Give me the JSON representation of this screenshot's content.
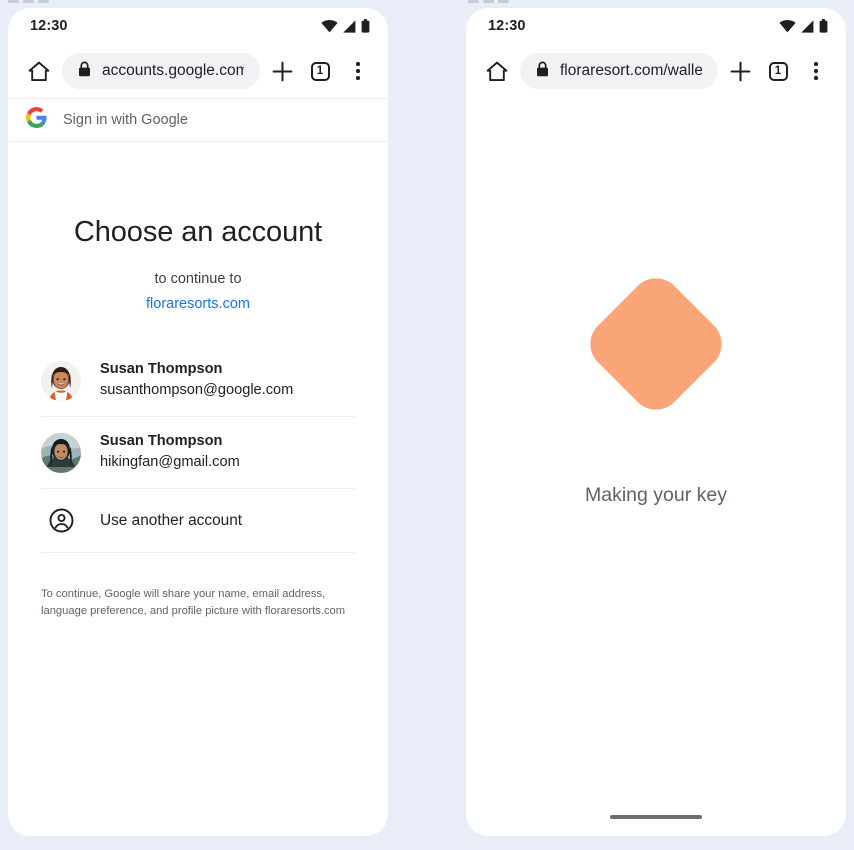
{
  "theme": {
    "page_background": "#e9edf7",
    "panel_background": "#ffffff",
    "link_blue": "#1a73e8",
    "key_shape_color": "#faa578",
    "muted_text": "#5f6368"
  },
  "phones": [
    {
      "id": "left",
      "status_bar": {
        "time": "12:30",
        "icons": [
          "wifi-icon",
          "cell-signal-icon",
          "battery-icon"
        ]
      },
      "toolbar": {
        "home_icon": "home-icon",
        "lock_icon": "lock-icon",
        "url": "accounts.google.com/o/",
        "new_tab_icon": "plus-icon",
        "tab_count": "1",
        "menu_icon": "overflow-menu-icon"
      },
      "google_header": {
        "logo": "google-g-icon",
        "label": "Sign in with Google"
      },
      "content": {
        "headline": "Choose an account",
        "subline": "to continue to",
        "app_domain": "floraresorts.com",
        "accounts": [
          {
            "name": "Susan Thompson",
            "email": "susanthompson@google.com",
            "avatar": "avatar-photo-smiling-woman"
          },
          {
            "name": "Susan Thompson",
            "email": "hikingfan@gmail.com",
            "avatar": "avatar-photo-woman-outdoors"
          }
        ],
        "use_another_account": {
          "icon": "account-circle-icon",
          "label": "Use another account"
        },
        "disclaimer": "To continue, Google will share your name, email address, language preference, and profile picture with floraresorts.com"
      }
    },
    {
      "id": "right",
      "status_bar": {
        "time": "12:30",
        "icons": [
          "wifi-icon",
          "cell-signal-icon",
          "battery-icon"
        ]
      },
      "toolbar": {
        "home_icon": "home-icon",
        "lock_icon": "lock-icon",
        "url": "floraresort.com/wallet-",
        "new_tab_icon": "plus-icon",
        "tab_count": "1",
        "menu_icon": "overflow-menu-icon"
      },
      "content": {
        "shape": "rounded-diamond-key-icon",
        "label": "Making your key"
      }
    }
  ]
}
